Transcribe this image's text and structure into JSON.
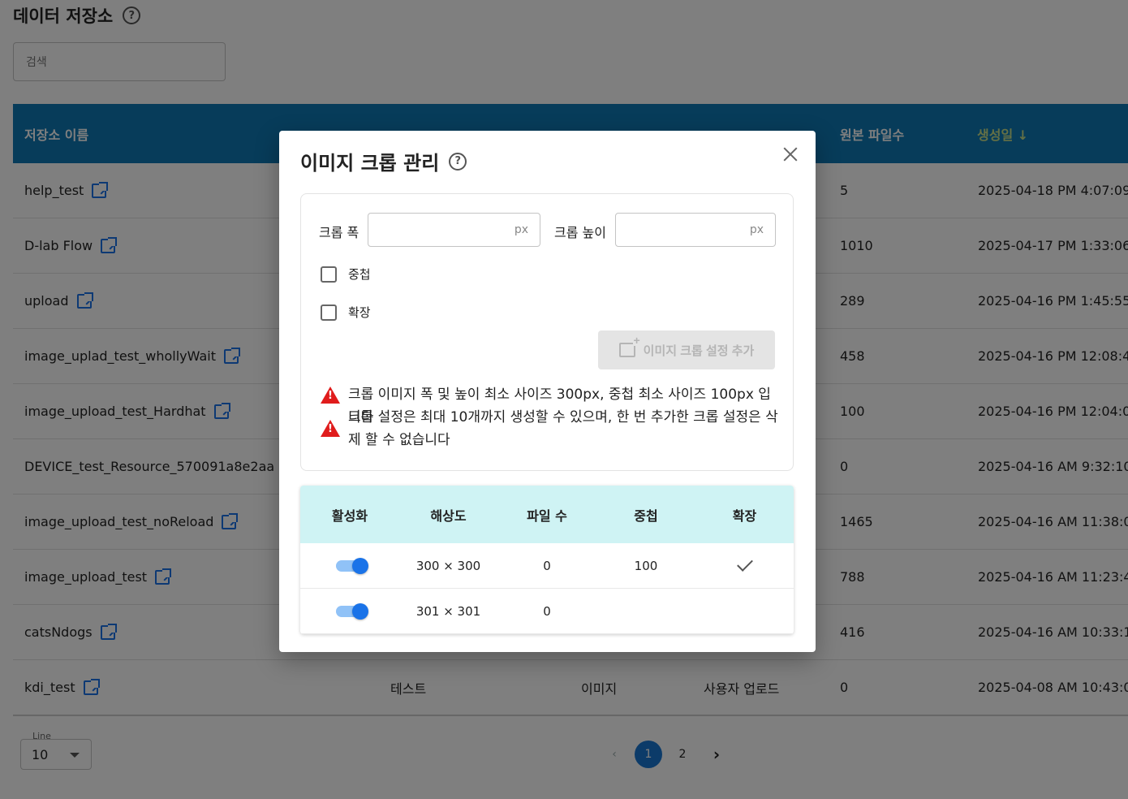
{
  "page": {
    "title": "데이터 저장소",
    "search_placeholder": "검색",
    "columns": {
      "name": "저장소 이름",
      "file_count": "원본 파일수",
      "created": "생성일 ↓"
    },
    "rows": [
      {
        "name": "help_test",
        "file_count": "5",
        "created": "2025-04-18 PM 4:07:09"
      },
      {
        "name": "D-lab Flow",
        "file_count": "1010",
        "created": "2025-04-17 PM 1:33:06"
      },
      {
        "name": "upload",
        "file_count": "289",
        "created": "2025-04-16 PM 1:45:55"
      },
      {
        "name": "image_uplad_test_whollyWait",
        "file_count": "458",
        "created": "2025-04-16 PM 12:08:4"
      },
      {
        "name": "image_upload_test_Hardhat",
        "file_count": "100",
        "created": "2025-04-16 PM 12:04:0"
      },
      {
        "name": "DEVICE_test_Resource_570091a8e2aa",
        "file_count": "0",
        "created": "2025-04-16 AM 9:32:10"
      },
      {
        "name": "image_upload_test_noReload",
        "file_count": "1465",
        "created": "2025-04-16 AM 11:38:0"
      },
      {
        "name": "image_upload_test",
        "file_count": "788",
        "created": "2025-04-16 AM 11:23:4"
      },
      {
        "name": "catsNdogs",
        "file_count": "416",
        "created": "2025-04-16 AM 10:33:1"
      },
      {
        "name": "kdi_test",
        "tag": "테스트",
        "type": "이미지",
        "storage": "사용자 업로드",
        "file_count": "0",
        "created": "2025-04-08 AM 10:43:0"
      }
    ],
    "line_label": "Line",
    "line_value": "10",
    "pages": [
      "1",
      "2"
    ],
    "prev_icon": "‹",
    "next_icon": "›"
  },
  "modal": {
    "title": "이미지 크롭 관리",
    "help_icon": "?",
    "width_label": "크롭 폭",
    "height_label": "크롭 높이",
    "unit": "px",
    "overlap_label": "중첩",
    "expand_label": "확장",
    "add_button": "이미지 크롭 설정 추가",
    "warnings": [
      "크롭 이미지 폭 및 높이 최소 사이즈 300px, 중첩 최소 사이즈 100px 입니다",
      "크롭 설정은 최대 10개까지 생성할 수 있으며, 한 번 추가한 크롭 설정은 삭제 할 수 없습니다"
    ],
    "table": {
      "headers": [
        "활성화",
        "해상도",
        "파일 수",
        "중첩",
        "확장"
      ],
      "rows": [
        {
          "resolution": "300 × 300",
          "files": "0",
          "overlap": "100",
          "expand": true
        },
        {
          "resolution": "301 × 301",
          "files": "0",
          "overlap": "",
          "expand": false
        }
      ]
    }
  }
}
